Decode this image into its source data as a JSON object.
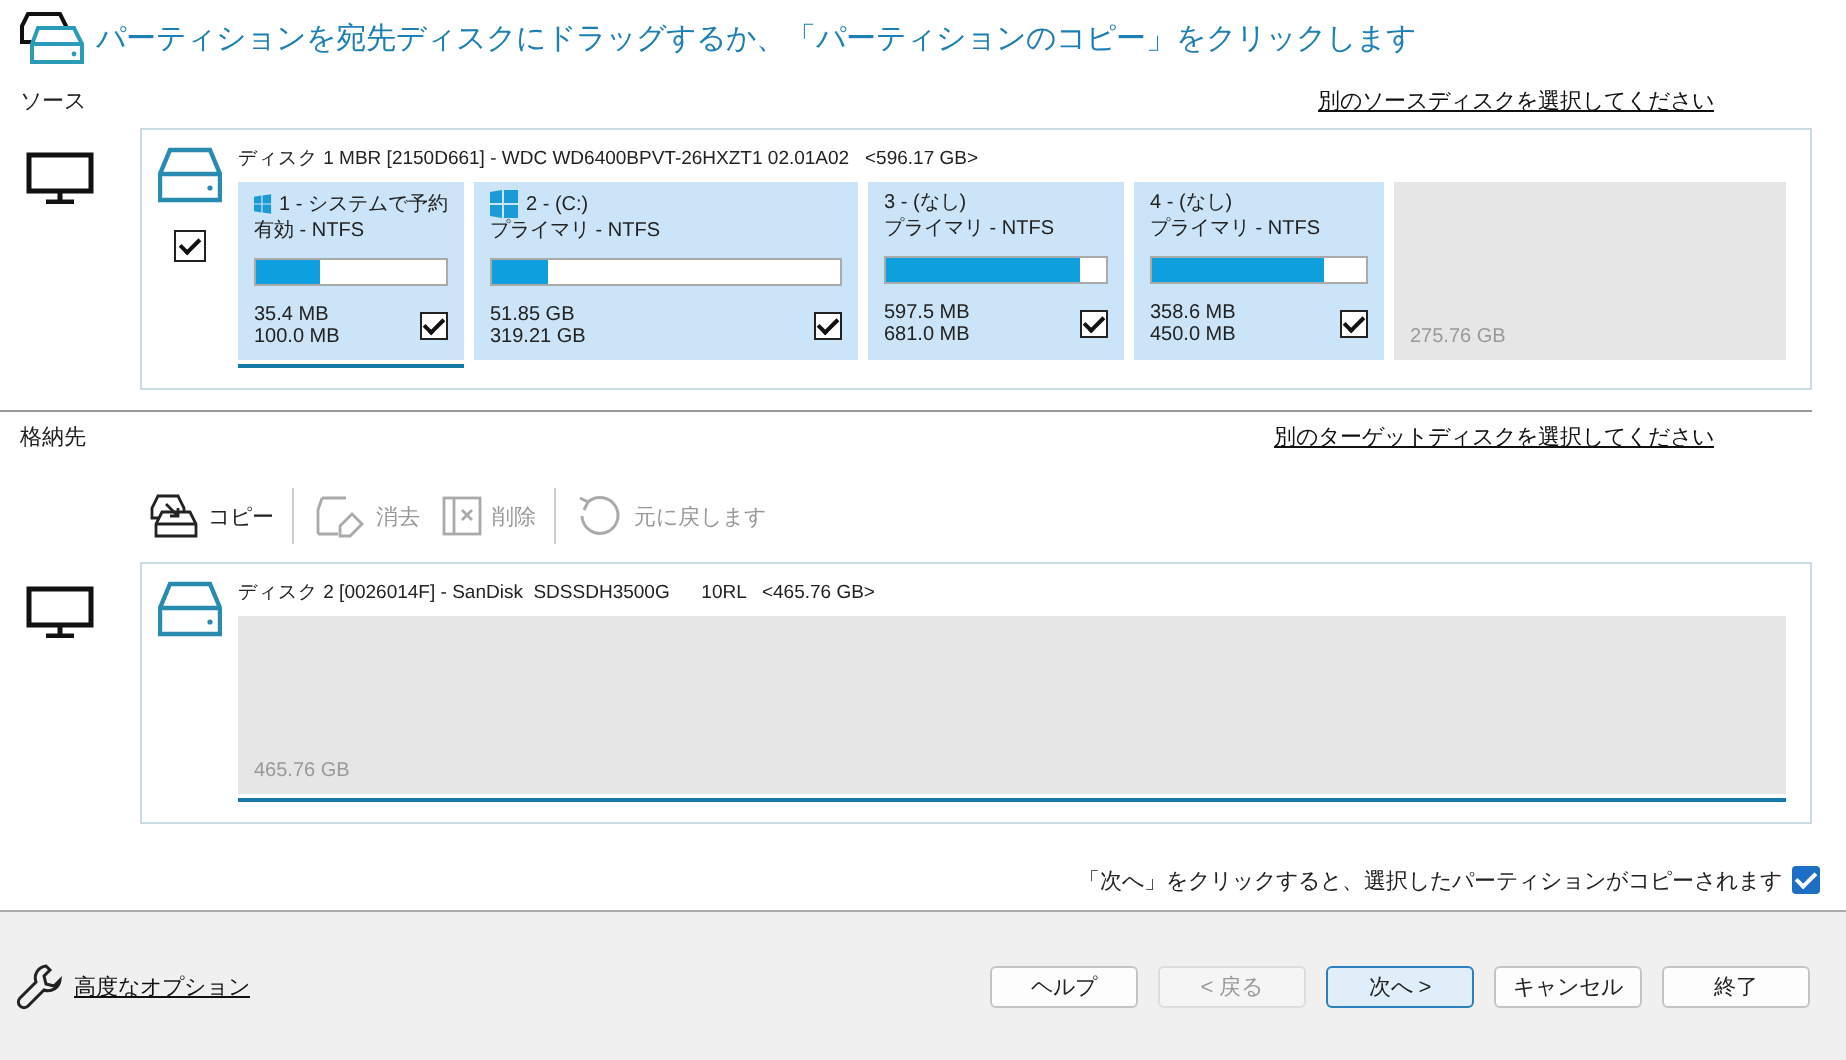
{
  "header": {
    "title": "パーティションを宛先ディスクにドラッグするか、「パーティションのコピー」をクリックします"
  },
  "source": {
    "label": "ソース",
    "link": "別のソースディスクを選択してください",
    "disk": {
      "checked": true,
      "label": "ディスク 1 MBR [2150D661] - WDC WD6400BPVT-26HXZT1 02.01A02   <596.17 GB>",
      "partitions": [
        {
          "kind": "partition",
          "windows": true,
          "title": "1 - システムで予約",
          "type": "有効 - NTFS",
          "level": 0.34,
          "used": "35.4 MB",
          "total": "100.0 MB",
          "checked": true,
          "selected": true
        },
        {
          "kind": "partition",
          "windows": true,
          "title": "2 -  (C:)",
          "type": "プライマリ - NTFS",
          "level": 0.16,
          "used": "51.85 GB",
          "total": "319.21 GB",
          "checked": true,
          "selected": false
        },
        {
          "kind": "partition",
          "windows": false,
          "title": "3 -  (なし)",
          "type": "プライマリ - NTFS",
          "level": 0.88,
          "used": "597.5 MB",
          "total": "681.0 MB",
          "checked": true,
          "selected": false
        },
        {
          "kind": "partition",
          "windows": false,
          "title": "4 -  (なし)",
          "type": "プライマリ - NTFS",
          "level": 0.8,
          "used": "358.6 MB",
          "total": "450.0 MB",
          "checked": true,
          "selected": false
        },
        {
          "kind": "unallocated",
          "size": "275.76 GB",
          "selected": false
        }
      ]
    }
  },
  "target": {
    "label": "格納先",
    "link": "別のターゲットディスクを選択してください",
    "toolbar": [
      {
        "label": "コピー",
        "disabled": false
      },
      {
        "label": "消去",
        "disabled": true
      },
      {
        "label": "削除",
        "disabled": true
      },
      {
        "label": "元に戻します",
        "disabled": true
      }
    ],
    "disk": {
      "label": "ディスク 2 [0026014F] - SanDisk  SDSSDH3500G      10RL   <465.76 GB>",
      "partitions": [
        {
          "kind": "unallocated",
          "size": "465.76 GB",
          "selected": true
        }
      ]
    }
  },
  "note": {
    "text": "「次へ」をクリックすると、選択したパーティションがコピーされます",
    "checked": true
  },
  "footer": {
    "options_link": "高度なオプション",
    "buttons": [
      {
        "label": "ヘルプ",
        "disabled": false,
        "default": false
      },
      {
        "label": "< 戻る",
        "disabled": true,
        "default": false
      },
      {
        "label": "次へ >",
        "disabled": false,
        "default": true
      },
      {
        "label": "キャンセル",
        "disabled": false,
        "default": false
      },
      {
        "label": "終了",
        "disabled": false,
        "default": false
      }
    ]
  }
}
